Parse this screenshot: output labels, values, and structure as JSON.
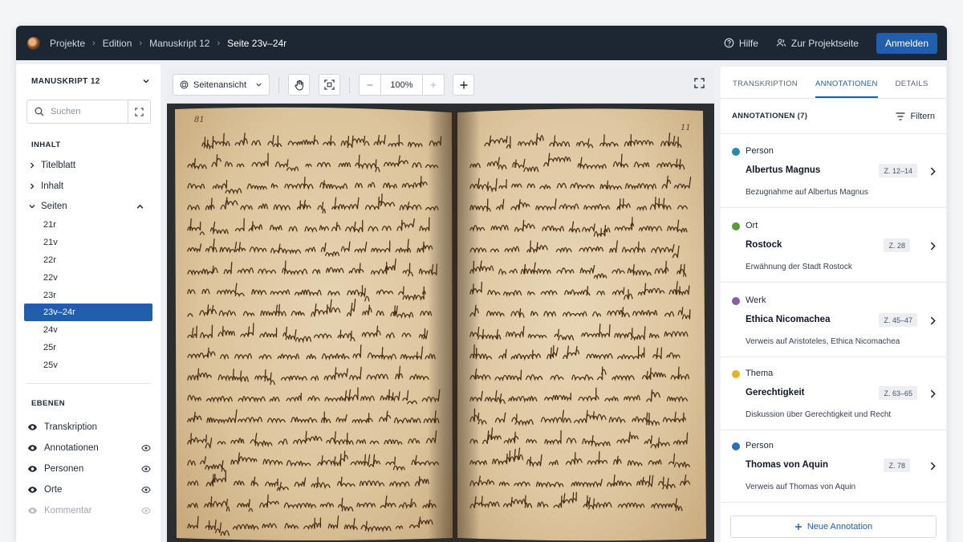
{
  "topbar": {
    "breadcrumbs": [
      "Projekte",
      "Edition",
      "Manuskript 12",
      "Seite 23v–24r"
    ],
    "help_label": "Hilfe",
    "project_label": "Zur Projektseite",
    "login_label": "Anmelden"
  },
  "sidebar": {
    "title": "MANUSKRIPT 12",
    "search_placeholder": "Suchen",
    "content_title": "INHALT",
    "tree": [
      {
        "label": "Titelblatt"
      },
      {
        "label": "Inhalt"
      },
      {
        "label": "Seiten"
      }
    ],
    "pages": [
      "21r",
      "21v",
      "22r",
      "22v",
      "23r",
      "23v–24r",
      "24v",
      "25r",
      "25v"
    ],
    "active_page": "23v–24r",
    "layers_title": "EBENEN",
    "layers": [
      {
        "label": "Transkription"
      },
      {
        "label": "Annotationen"
      },
      {
        "label": "Personen"
      },
      {
        "label": "Orte"
      },
      {
        "label": "Kommentar"
      }
    ]
  },
  "viewer": {
    "view_mode": "Seitenansicht",
    "zoom": "100%",
    "folio_left": "81",
    "folio_right": "11"
  },
  "panel": {
    "tabs": [
      "TRANSKRIPTION",
      "ANNOTATIONEN",
      "DETAILS"
    ],
    "active_tab": "ANNOTATIONEN",
    "header": "ANNOTATIONEN (7)",
    "filter_label": "Filtern",
    "annotations": [
      {
        "type": "Person",
        "name": "Albertus Magnus",
        "lines": "Z. 12–14",
        "desc": "Bezugnahme auf Albertus Magnus",
        "color": "#2b8aa8"
      },
      {
        "type": "Ort",
        "name": "Rostock",
        "lines": "Z. 28",
        "desc": "Erwähnung der Stadt Rostock",
        "color": "#5a9a3f"
      },
      {
        "type": "Werk",
        "name": "Ethica Nicomachea",
        "lines": "Z. 45–47",
        "desc": "Verweis auf Aristoteles, Ethica Nicomachea",
        "color": "#8c5ba8"
      },
      {
        "type": "Thema",
        "name": "Gerechtigkeit",
        "lines": "Z. 63–65",
        "desc": "Diskussion über Gerechtigkeit und Recht",
        "color": "#e0b52a"
      },
      {
        "type": "Person",
        "name": "Thomas von Aquin",
        "lines": "Z. 78",
        "desc": "Verweis auf Thomas von Aquin",
        "color": "#2d6fb8"
      }
    ],
    "new_label": "Neue Annotation"
  },
  "colors": {
    "accent": "#1f5fad",
    "topbar": "#1c2733"
  }
}
